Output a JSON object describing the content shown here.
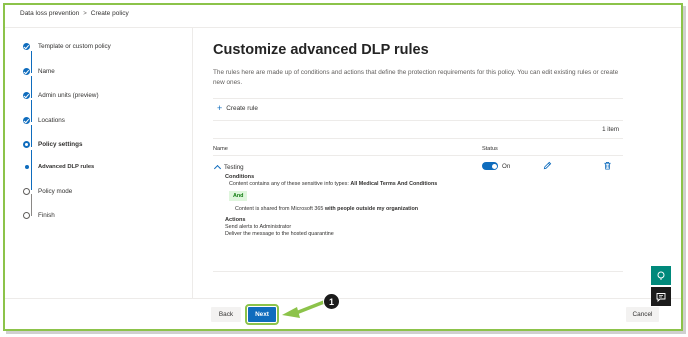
{
  "breadcrumb": [
    "Data loss prevention",
    "Create policy"
  ],
  "breadcrumb_separator": ">",
  "steps": [
    {
      "label": "Template or custom policy",
      "state": "done"
    },
    {
      "label": "Name",
      "state": "done"
    },
    {
      "label": "Admin units (preview)",
      "state": "done"
    },
    {
      "label": "Locations",
      "state": "done"
    },
    {
      "label": "Policy settings",
      "state": "current"
    },
    {
      "label": "Advanced DLP rules",
      "state": "sub-current"
    },
    {
      "label": "Policy mode",
      "state": "todo"
    },
    {
      "label": "Finish",
      "state": "todo"
    }
  ],
  "main": {
    "title": "Customize advanced DLP rules",
    "description": "The rules here are made up of conditions and actions that define the protection requirements for this policy. You can edit existing rules or create new ones.",
    "create_rule": "Create rule",
    "count": "1 item",
    "columns": {
      "name": "Name",
      "status": "Status"
    },
    "rule": {
      "name": "Testing",
      "status": "On",
      "conditions_heading": "Conditions",
      "condition1_prefix": "Content contains any of these sensitive info types: ",
      "condition1_value": "All Medical Terms And Conditions",
      "and_label": "And",
      "condition2_prefix": "Content is shared from Microsoft 365 ",
      "condition2_value": "with people outside my organization",
      "actions_heading": "Actions",
      "actions": [
        "Send alerts to Administrator",
        "Deliver the message to the hosted quarantine"
      ]
    }
  },
  "footer": {
    "back": "Back",
    "next": "Next",
    "cancel": "Cancel"
  },
  "callout_number": "1",
  "colors": {
    "accent": "#0f6cbd",
    "highlight": "#8cc34a",
    "help": "#00897b"
  },
  "icons": [
    "plus-icon",
    "chevron-up-icon",
    "edit-icon",
    "delete-icon",
    "help-icon",
    "chat-icon",
    "checkmark-icon"
  ]
}
